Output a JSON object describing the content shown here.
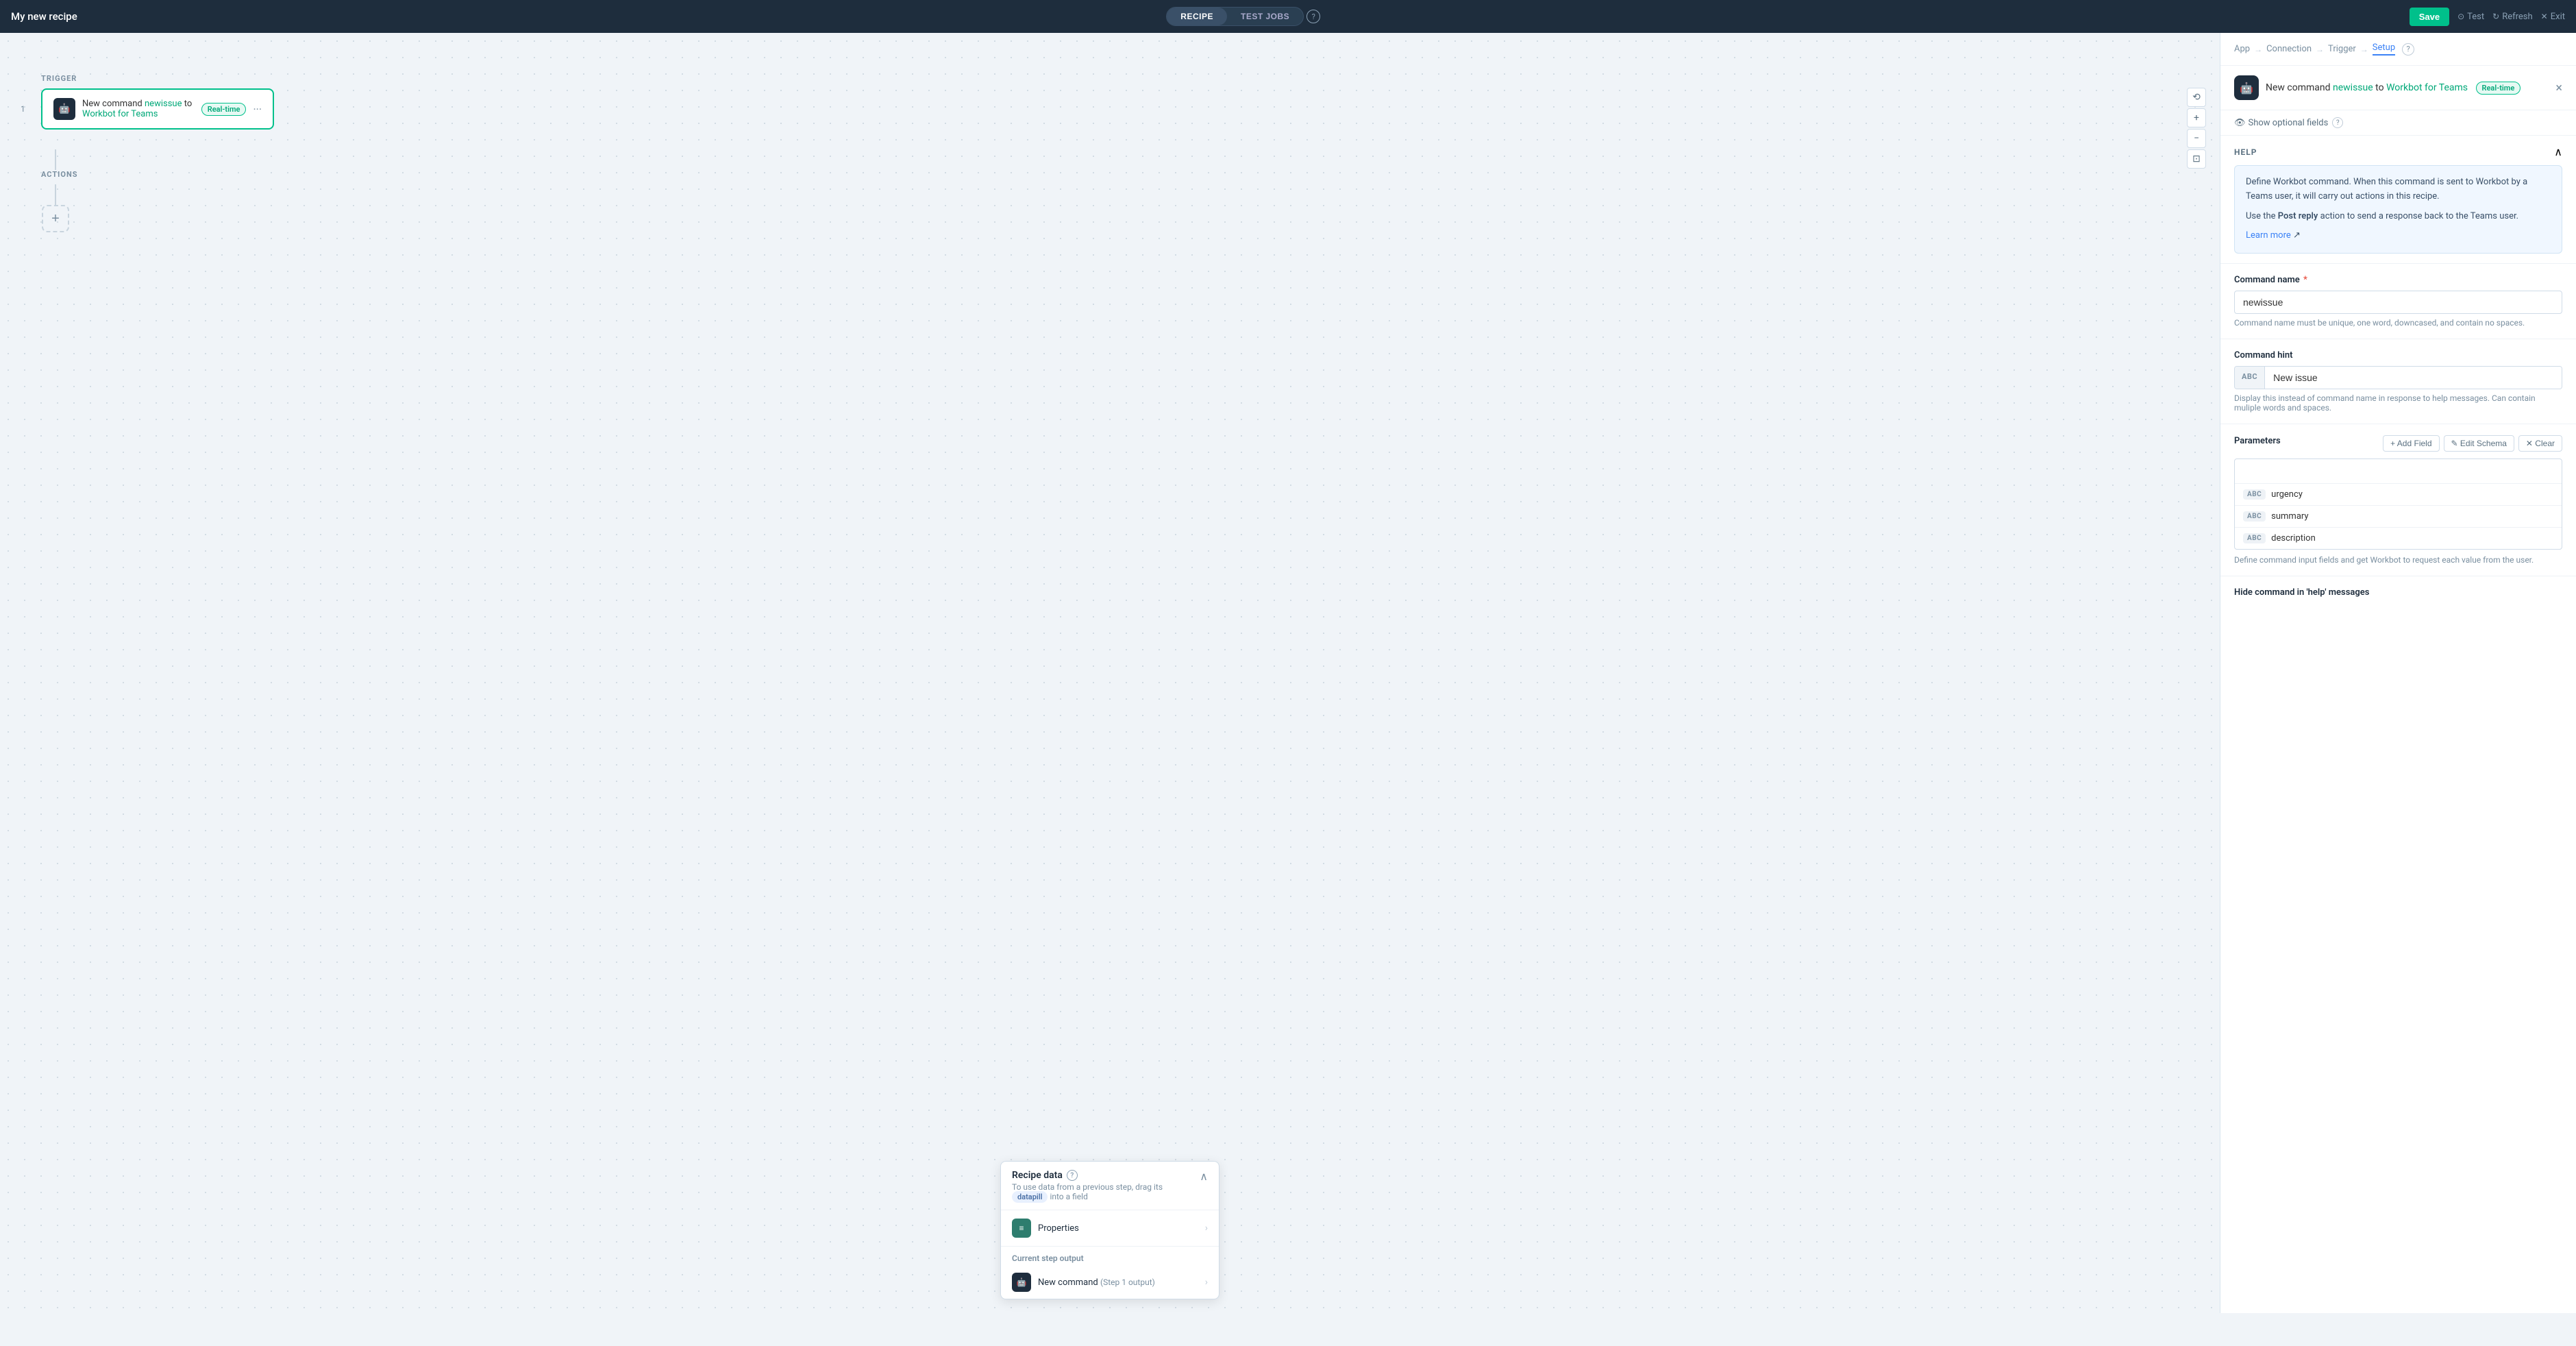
{
  "topbar": {
    "title": "My new recipe",
    "tabs": [
      {
        "id": "recipe",
        "label": "RECIPE",
        "active": true
      },
      {
        "id": "testjobs",
        "label": "TEST JOBS",
        "active": false
      }
    ],
    "save_label": "Save",
    "test_label": "Test",
    "refresh_label": "Refresh",
    "exit_label": "Exit"
  },
  "canvas": {
    "trigger_label": "TRIGGER",
    "actions_label": "ACTIONS",
    "step_number": "1",
    "trigger": {
      "text_prefix": "New command",
      "link1": "newissue",
      "text_mid": " to ",
      "link2": "Workbot for Teams",
      "badge": "Real-time"
    },
    "add_action_plus": "+"
  },
  "recipe_data_panel": {
    "title": "Recipe data",
    "subtitle": "To use data from a previous step, drag its",
    "datapill": "datapill",
    "subtitle_end": "into a field",
    "properties_label": "Properties",
    "current_step_output": "Current step output",
    "new_command_label": "New command",
    "step_label": "(Step 1 output)"
  },
  "right_panel": {
    "breadcrumb": {
      "app": "App",
      "connection": "Connection",
      "trigger": "Trigger",
      "setup": "Setup"
    },
    "header": {
      "text_prefix": "New command",
      "link1": "newissue",
      "text_mid": " to ",
      "link2": "Workbot for Teams",
      "badge": "Real-time",
      "close_icon": "×"
    },
    "optional_fields": {
      "label": "Show optional fields"
    },
    "help": {
      "title": "HELP",
      "paragraph1": "Define Workbot command. When this command is sent to Workbot by a Teams user, it will carry out actions in this recipe.",
      "paragraph2_prefix": "Use the ",
      "paragraph2_bold": "Post reply",
      "paragraph2_suffix": " action to send a response back to the Teams user.",
      "learn_more": "Learn more"
    },
    "command_name": {
      "label": "Command name",
      "required": true,
      "value": "newissue",
      "hint": "Command name must be unique, one word, downcased, and contain no spaces."
    },
    "command_hint": {
      "label": "Command hint",
      "prefix": "ABC",
      "value": "New issue",
      "hint": "Display this instead of command name in response to help messages. Can contain muliple words and spaces."
    },
    "parameters": {
      "label": "Parameters",
      "add_field_label": "+ Add Field",
      "edit_schema_label": "✎ Edit Schema",
      "clear_label": "✕ Clear",
      "empty_row": "",
      "fields": [
        {
          "type": "ABC",
          "name": "urgency"
        },
        {
          "type": "ABC",
          "name": "summary"
        },
        {
          "type": "ABC",
          "name": "description"
        }
      ],
      "hint": "Define command input fields and get Workbot to request each value from the user."
    },
    "hide_command": {
      "label": "Hide command in 'help' messages"
    }
  }
}
